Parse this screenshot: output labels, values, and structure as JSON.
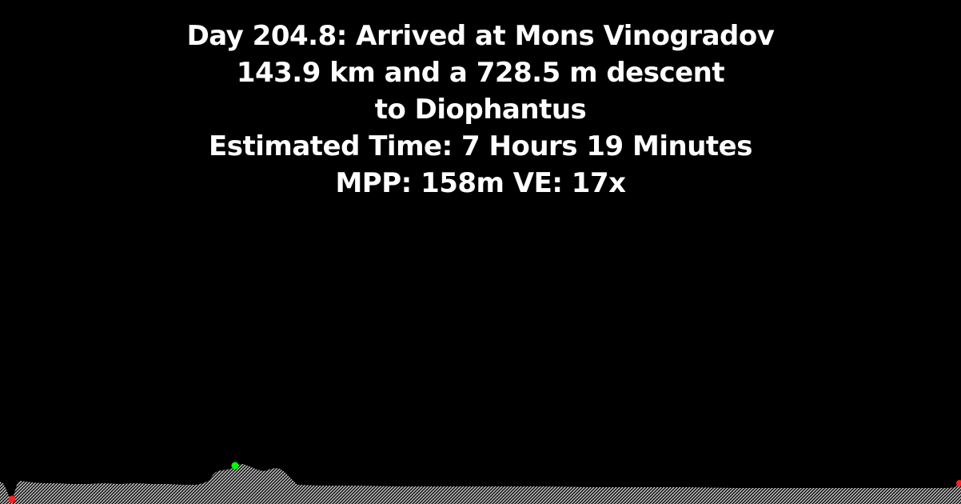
{
  "caption": {
    "line1": "Day 204.8: Arrived at Mons Vinogradov",
    "line2": "143.9 km and a 728.5 m descent",
    "line3": "to Diophantus",
    "line4": "Estimated Time: 7 Hours 19 Minutes",
    "line5": "MPP: 158m VE: 17x"
  },
  "profile": {
    "fill_color": "#cfcfcf",
    "current_marker_color": "#00ff00",
    "endpoint_marker_color": "#ff2020"
  }
}
